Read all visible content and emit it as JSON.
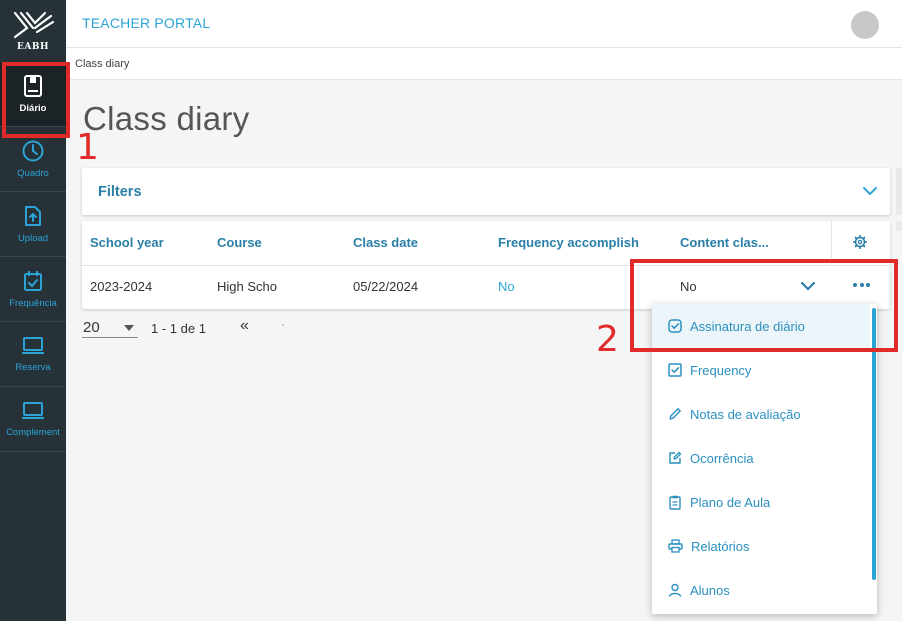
{
  "app": {
    "logo_text": "EABH",
    "portal_title": "TEACHER PORTAL"
  },
  "sidebar": {
    "items": [
      {
        "label": "Diário",
        "icon": "book-icon",
        "active": true
      },
      {
        "label": "Quadro",
        "icon": "clock-icon",
        "active": false
      },
      {
        "label": "Upload",
        "icon": "upload-file-icon",
        "active": false
      },
      {
        "label": "Frequência",
        "icon": "calendar-check-icon",
        "active": false
      },
      {
        "label": "Reserva",
        "icon": "laptop-icon",
        "active": false
      },
      {
        "label": "Complement",
        "icon": "laptop-icon",
        "active": false
      }
    ]
  },
  "breadcrumb": "Class diary",
  "page_title": "Class diary",
  "filters": {
    "title": "Filters"
  },
  "table": {
    "columns": [
      "School year",
      "Course",
      "Class date",
      "Frequency accomplish",
      "Content clas..."
    ],
    "rows": [
      {
        "school_year": "2023-2024",
        "course": "High Scho",
        "class_date": "05/22/2024",
        "frequency": "No",
        "content": "No"
      }
    ]
  },
  "pagination": {
    "page_size": "20",
    "range": "1 - 1 de 1",
    "first": "«"
  },
  "dropdown_menu": {
    "items": [
      {
        "label": "Assinatura de diário",
        "icon": "check-square-icon"
      },
      {
        "label": "Frequency",
        "icon": "check-square-icon"
      },
      {
        "label": "Notas de avaliação",
        "icon": "pencil-icon"
      },
      {
        "label": "Ocorrência",
        "icon": "edit-note-icon"
      },
      {
        "label": "Plano de Aula",
        "icon": "clipboard-icon"
      },
      {
        "label": "Relatórios",
        "icon": "printer-icon"
      },
      {
        "label": "Alunos",
        "icon": "user-icon"
      }
    ]
  },
  "annotations": {
    "marker_1": "1",
    "marker_2": "2"
  },
  "colors": {
    "sidebar_bg": "#263238",
    "accent": "#2ba3d6",
    "header_text": "#2a7fa8",
    "annotation": "#e12a2a"
  }
}
